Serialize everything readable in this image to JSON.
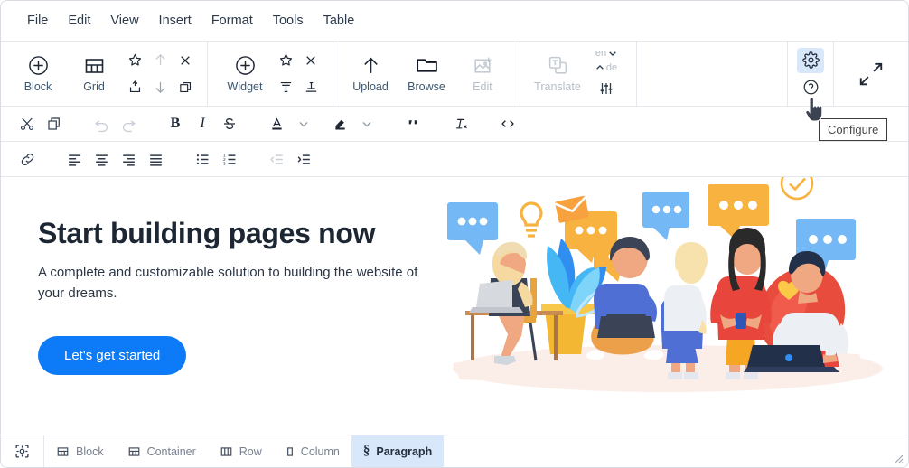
{
  "menubar": {
    "items": [
      {
        "label": "File",
        "name": "menu-file"
      },
      {
        "label": "Edit",
        "name": "menu-edit"
      },
      {
        "label": "View",
        "name": "menu-view"
      },
      {
        "label": "Insert",
        "name": "menu-insert"
      },
      {
        "label": "Format",
        "name": "menu-format"
      },
      {
        "label": "Tools",
        "name": "menu-tools"
      },
      {
        "label": "Table",
        "name": "menu-table"
      }
    ]
  },
  "toolbar_main": {
    "block_label": "Block",
    "grid_label": "Grid",
    "widget_label": "Widget",
    "upload_label": "Upload",
    "browse_label": "Browse",
    "edit_label": "Edit",
    "translate_label": "Translate",
    "lang_from": "en",
    "lang_to": "de",
    "icons": {
      "block": "plus-circle-icon",
      "grid": "grid-table-icon",
      "favorite": "star-icon",
      "move_up": "arrow-up-icon",
      "remove": "close-x-icon",
      "insert_block": "insert-box-icon",
      "move_down": "arrow-down-icon",
      "duplicate": "duplicate-icon",
      "widget": "plus-circle-icon",
      "widget_favorite": "star-icon",
      "widget_remove": "close-x-icon",
      "align_top": "align-top-icon",
      "align_bottom": "align-bottom-icon",
      "upload": "arrow-up-icon",
      "browse": "folder-icon",
      "edit_image": "image-edit-icon",
      "translate": "translate-icon",
      "lang_from_chevron": "chevron-down-icon",
      "lang_to_chevron": "chevron-up-icon",
      "settings_sliders": "sliders-icon",
      "configure": "gear-icon",
      "help": "help-circle-icon",
      "fullscreen": "expand-arrows-icon"
    },
    "tooltip": "Configure"
  },
  "toolbar_format": {
    "icons": [
      {
        "name": "cut-icon",
        "state": "enabled"
      },
      {
        "name": "copy-icon",
        "state": "enabled"
      },
      {
        "name": "undo-icon",
        "state": "disabled"
      },
      {
        "name": "redo-icon",
        "state": "disabled"
      },
      {
        "name": "bold-icon",
        "state": "enabled"
      },
      {
        "name": "italic-icon",
        "state": "enabled"
      },
      {
        "name": "strikethrough-icon",
        "state": "enabled"
      },
      {
        "name": "text-color-icon",
        "state": "enabled"
      },
      {
        "name": "text-color-chevron-down-icon",
        "state": "enabled"
      },
      {
        "name": "highlight-color-icon",
        "state": "enabled"
      },
      {
        "name": "highlight-color-chevron-down-icon",
        "state": "enabled"
      },
      {
        "name": "blockquote-icon",
        "state": "enabled"
      },
      {
        "name": "clear-formatting-icon",
        "state": "enabled"
      },
      {
        "name": "source-code-icon",
        "state": "enabled"
      }
    ]
  },
  "toolbar_paragraph": {
    "icons": [
      {
        "name": "link-icon",
        "state": "enabled"
      },
      {
        "name": "align-left-icon",
        "state": "enabled"
      },
      {
        "name": "align-center-icon",
        "state": "enabled"
      },
      {
        "name": "align-right-icon",
        "state": "enabled"
      },
      {
        "name": "align-justify-icon",
        "state": "enabled"
      },
      {
        "name": "bullet-list-icon",
        "state": "enabled"
      },
      {
        "name": "numbered-list-icon",
        "state": "enabled"
      },
      {
        "name": "outdent-icon",
        "state": "disabled"
      },
      {
        "name": "indent-icon",
        "state": "enabled"
      }
    ]
  },
  "canvas": {
    "heading": "Start building pages now",
    "paragraph": "A complete and customizable solution to building the website of your dreams.",
    "button_label": "Let's get started",
    "illustration_name": "team-collaboration-illustration"
  },
  "statusbar": {
    "target_icon": "selection-target-icon",
    "breadcrumb": [
      {
        "label": "Block",
        "icon": "grid-table-icon",
        "active": false
      },
      {
        "label": "Container",
        "icon": "grid-table-icon",
        "active": false
      },
      {
        "label": "Row",
        "icon": "columns-icon",
        "active": false
      },
      {
        "label": "Column",
        "icon": "single-column-icon",
        "active": false
      },
      {
        "label": "Paragraph",
        "icon": "paragraph-mark-icon",
        "active": true
      }
    ],
    "resize_grip": "resize-grip-icon"
  },
  "colors": {
    "accent_blue": "#0d7bf7",
    "highlight_blue": "#d9e7fb",
    "text_dark": "#1d2633",
    "muted": "#b4bcc6"
  }
}
